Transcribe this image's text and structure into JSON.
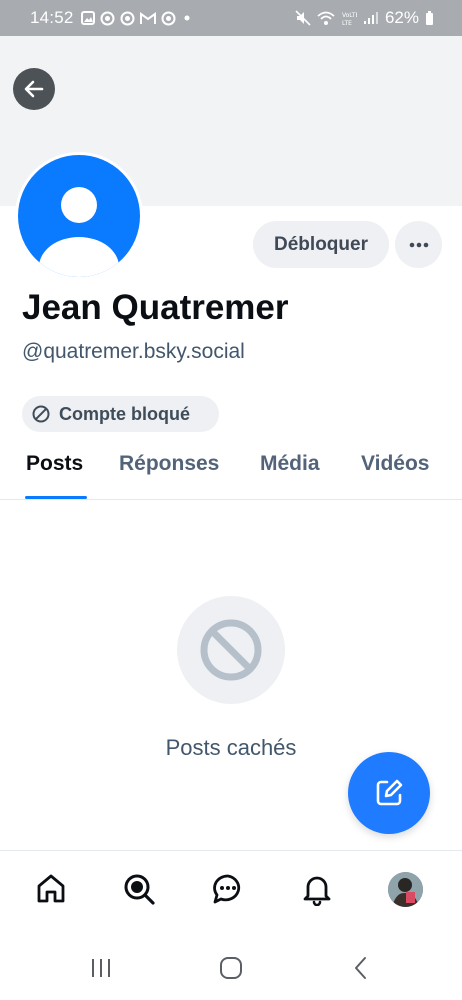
{
  "status_bar": {
    "time": "14:52",
    "battery": "62%",
    "left_icons": [
      "image-icon",
      "circle-app-icon",
      "circle-app-icon",
      "gmail-icon",
      "circle-app-icon",
      "dot-icon"
    ],
    "right_icons": [
      "mute-icon",
      "wifi-icon",
      "volte-icon",
      "signal-icon",
      "battery-icon"
    ]
  },
  "profile": {
    "display_name": "Jean Quatremer",
    "handle": "@quatremer.bsky.social",
    "blocked_label": "Compte bloqué",
    "unblock_label": "Débloquer",
    "more_label": "···"
  },
  "tabs": [
    {
      "label": "Posts",
      "active": true
    },
    {
      "label": "Réponses",
      "active": false
    },
    {
      "label": "Média",
      "active": false
    },
    {
      "label": "Vidéos",
      "active": false
    }
  ],
  "empty_state": {
    "icon": "ban-icon",
    "text": "Posts cachés"
  },
  "bottom_nav": [
    "home-icon",
    "search-icon",
    "chat-icon",
    "bell-icon",
    "profile-avatar"
  ],
  "system_nav": [
    "recents-icon",
    "home-circle-icon",
    "back-chevron-icon"
  ],
  "colors": {
    "accent": "#0a7aff",
    "fab": "#1f7bff",
    "banner": "#f1f3f5",
    "button_bg": "#eef0f3",
    "muted_text": "#42576c"
  }
}
